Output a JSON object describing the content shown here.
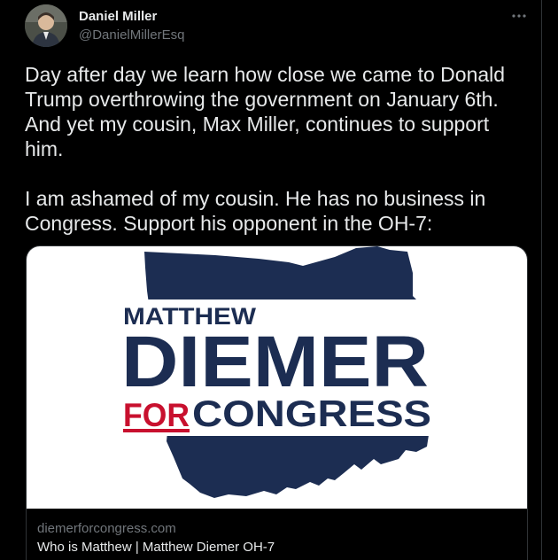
{
  "author": {
    "name": "Daniel Miller",
    "handle": "@DanielMillerEsq"
  },
  "tweet": {
    "text": "Day after day we learn how close we came to Donald Trump overthrowing the government on January 6th. And yet my cousin, Max Miller, continues to support him.\n\nI am ashamed of my cousin. He has no business in Congress. Support his opponent in the OH-7:"
  },
  "card": {
    "logo": {
      "line1": "MATTHEW",
      "line2": "DIEMER",
      "for": "FOR",
      "congress": "CONGRESS",
      "navy": "#1c2d52",
      "red": "#c8102e"
    },
    "domain": "diemerforcongress.com",
    "title": "Who is Matthew | Matthew Diemer OH-7"
  },
  "icons": {
    "more": "more-options-icon",
    "avatar": "avatar"
  }
}
